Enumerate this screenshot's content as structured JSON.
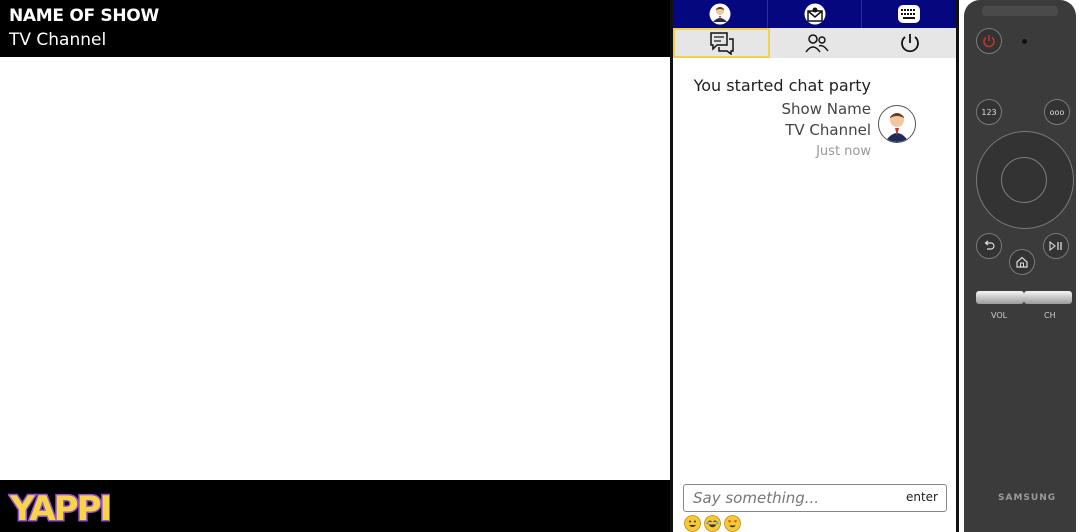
{
  "tv": {
    "show_name": "NAME OF SHOW",
    "channel": "TV Channel",
    "logo_text": "YAPPI"
  },
  "panel": {
    "top_icons": [
      "profile-icon",
      "invite-mail-icon",
      "keyboard-icon"
    ],
    "tabs": [
      "chat-icon",
      "people-icon",
      "power-icon"
    ],
    "active_tab": "chat"
  },
  "chat": {
    "message_title": "You started chat party",
    "show_name": "Show Name",
    "channel": "TV Channel",
    "time": "Just now",
    "input_placeholder": "Say something...",
    "enter_label": "enter",
    "emojis": [
      "grinning-emoji",
      "laughing-emoji",
      "heart-eyes-emoji"
    ]
  },
  "remote": {
    "btn_123": "123",
    "btn_more": "ooo",
    "vol_label": "VOL",
    "ch_label": "CH",
    "brand": "SAMSUNG"
  },
  "colors": {
    "header_bg": "#000000",
    "panel_top_bg": "#04077d",
    "active_tab_border": "#f2d24a",
    "remote_body": "#3b3b3b",
    "power_red": "#c0392b"
  }
}
